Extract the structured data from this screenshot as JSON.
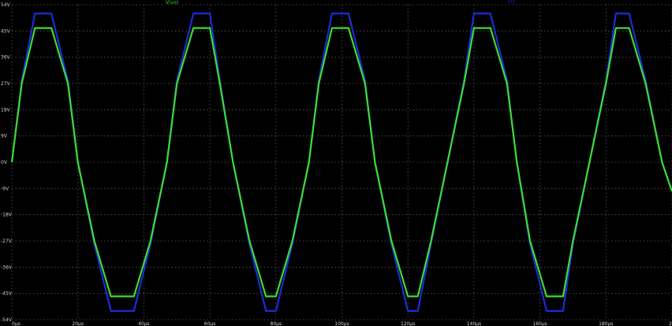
{
  "chart_data": {
    "type": "line",
    "background": "#000000",
    "grid": true,
    "grid_color": "#5a5a5a",
    "legend_placement": "top",
    "x_unit": "µs",
    "xlim": [
      0,
      200
    ],
    "ylim": [
      -54,
      54
    ],
    "y_ticks": [
      54,
      45,
      36,
      27,
      18,
      9,
      0,
      -9,
      -18,
      -27,
      -36,
      -45,
      -54
    ],
    "y_tick_labels": [
      "54V",
      "45V",
      "36V",
      "27V",
      "18V",
      "9V",
      "0V",
      "-9V",
      "-18V",
      "-27V",
      "-36V",
      "-45V",
      "-54V"
    ],
    "x_ticks": [
      0,
      20,
      40,
      60,
      80,
      100,
      120,
      140,
      160,
      180,
      200
    ],
    "x_tick_labels": [
      "0µs",
      "20µs",
      "40µs",
      "60µs",
      "80µs",
      "100µs",
      "120µs",
      "140µs",
      "160µs",
      "180µs",
      "2"
    ],
    "series": [
      {
        "name": "",
        "legend_text": "???",
        "color": "#1e2bd6",
        "x": [
          0,
          3,
          7,
          12,
          17,
          20,
          25,
          30,
          33,
          37,
          42,
          47,
          50,
          55,
          60,
          63,
          67,
          72,
          77,
          80,
          85,
          90,
          93,
          97,
          102,
          107,
          110,
          115,
          120,
          123,
          127,
          132,
          137,
          140,
          145,
          150,
          153,
          157,
          162,
          167,
          170,
          175,
          180,
          183,
          187,
          192,
          197,
          200
        ],
        "values": [
          0,
          28,
          51,
          51,
          28,
          0,
          -28,
          -51,
          -51,
          -51,
          -28,
          0,
          28,
          51,
          51,
          28,
          0,
          -28,
          -51,
          -51,
          -28,
          0,
          28,
          51,
          51,
          28,
          0,
          -28,
          -51,
          -51,
          -28,
          0,
          28,
          51,
          51,
          28,
          0,
          -28,
          -51,
          -51,
          -28,
          0,
          28,
          51,
          51,
          28,
          0,
          -10
        ]
      },
      {
        "name": "V(vo)",
        "legend_text": "V(vo)",
        "color": "#3cdc2f",
        "x": [
          0,
          3,
          7,
          12,
          17,
          20,
          25,
          30,
          33,
          37,
          42,
          47,
          50,
          55,
          60,
          63,
          67,
          72,
          77,
          80,
          85,
          90,
          93,
          97,
          102,
          107,
          110,
          115,
          120,
          123,
          127,
          132,
          137,
          140,
          145,
          150,
          153,
          157,
          162,
          167,
          170,
          175,
          180,
          183,
          187,
          192,
          197,
          200
        ],
        "values": [
          0,
          27,
          46,
          46,
          27,
          0,
          -27,
          -46,
          -46,
          -46,
          -27,
          0,
          27,
          46,
          46,
          27,
          0,
          -27,
          -46,
          -46,
          -27,
          0,
          27,
          46,
          46,
          27,
          0,
          -27,
          -46,
          -46,
          -27,
          0,
          27,
          46,
          46,
          27,
          0,
          -27,
          -46,
          -46,
          -27,
          0,
          27,
          46,
          46,
          27,
          0,
          -10
        ]
      }
    ]
  }
}
